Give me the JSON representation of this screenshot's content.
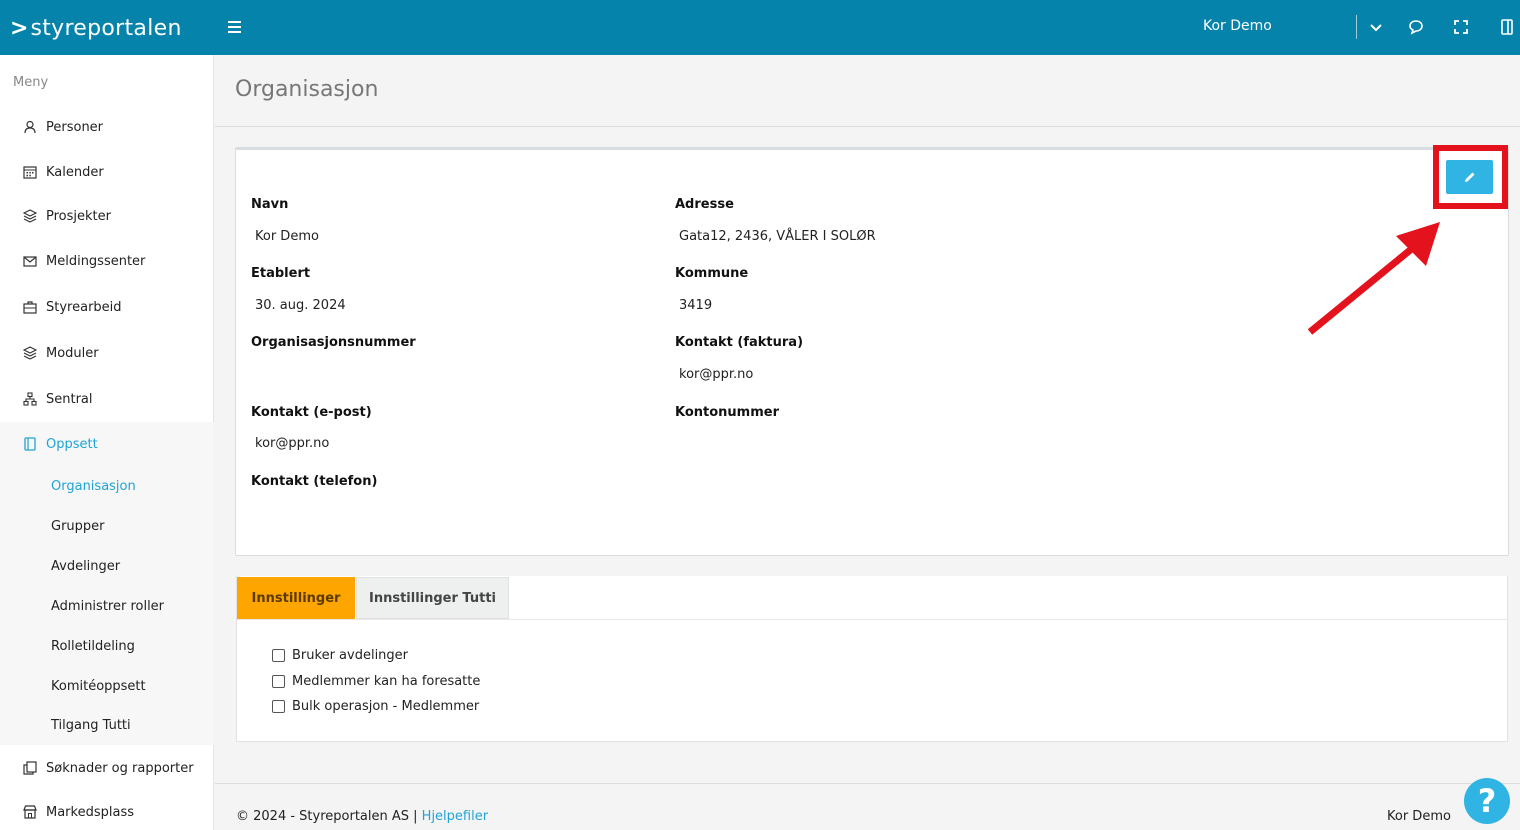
{
  "topbar": {
    "brand": "styreportalen",
    "user_name": "Kor Demo",
    "icons": [
      "menu-icon",
      "chevron-down-icon",
      "chat-icon",
      "fullscreen-icon",
      "panel-icon"
    ]
  },
  "sidebar": {
    "menu_label": "Meny",
    "items": [
      {
        "label": "Personer",
        "icon": "person-icon"
      },
      {
        "label": "Kalender",
        "icon": "calendar-icon"
      },
      {
        "label": "Prosjekter",
        "icon": "layers-icon"
      },
      {
        "label": "Meldingssenter",
        "icon": "mail-icon"
      },
      {
        "label": "Styrearbeid",
        "icon": "briefcase-icon"
      },
      {
        "label": "Moduler",
        "icon": "layers-icon"
      },
      {
        "label": "Sentral",
        "icon": "sitemap-icon"
      },
      {
        "label": "Oppsett",
        "icon": "book-icon"
      },
      {
        "label": "Søknader og rapporter",
        "icon": "copy-icon"
      },
      {
        "label": "Markedsplass",
        "icon": "store-icon"
      }
    ],
    "subitems": [
      "Organisasjon",
      "Grupper",
      "Avdelinger",
      "Administrer roller",
      "Rolletildeling",
      "Komitéoppsett",
      "Tilgang Tutti"
    ]
  },
  "page": {
    "title": "Organisasjon"
  },
  "org": {
    "navn_label": "Navn",
    "navn_value": "Kor Demo",
    "etablert_label": "Etablert",
    "etablert_value": "30. aug. 2024",
    "orgnr_label": "Organisasjonsnummer",
    "kontakt_epost_label": "Kontakt (e-post)",
    "kontakt_epost_value": "kor@ppr.no",
    "kontakt_telefon_label": "Kontakt (telefon)",
    "adresse_label": "Adresse",
    "adresse_value": "Gata12, 2436, VÅLER I SOLØR",
    "kommune_label": "Kommune",
    "kommune_value": "3419",
    "kontakt_faktura_label": "Kontakt (faktura)",
    "kontakt_faktura_value": "kor@ppr.no",
    "kontonummer_label": "Kontonummer"
  },
  "tabs": [
    {
      "label": "Innstillinger"
    },
    {
      "label": "Innstillinger Tutti"
    }
  ],
  "settings": [
    {
      "label": "Bruker avdelinger",
      "checked": false
    },
    {
      "label": "Medlemmer kan ha foresatte",
      "checked": false
    },
    {
      "label": "Bulk operasjon - Medlemmer",
      "checked": false
    }
  ],
  "footer": {
    "copyright": "© 2024 - Styreportalen AS |",
    "help_link": "Hjelpefiler",
    "right_user": "Kor Demo",
    "help_button": "?"
  },
  "colors": {
    "topbar": "#0583ab",
    "accent": "#1fa4d6",
    "active_tab": "#ffa500",
    "highlight": "#e3121d"
  }
}
